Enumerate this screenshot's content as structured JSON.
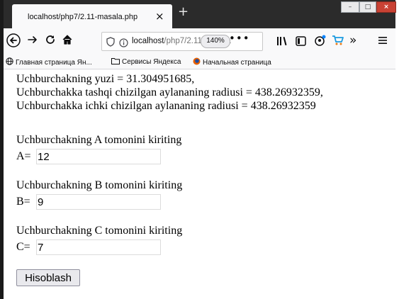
{
  "browser": {
    "tab_title": "localhost/php7/2.11-masala.php",
    "tab_close": "×",
    "new_tab": "+",
    "window_buttons": [
      "–",
      "□",
      "×"
    ],
    "url_host": "localhost",
    "url_path": "/php7/2.11-masala",
    "zoom": "140%",
    "menu_dots": "•••",
    "bookmarks": [
      {
        "icon": "globe-icon",
        "label": "Главная страница Ян..."
      },
      {
        "icon": "folder-icon",
        "label": "Сервисы Яндекса"
      },
      {
        "icon": "firefox-icon",
        "label": "Начальная страница"
      }
    ]
  },
  "results": {
    "area": "Uchburchakning yuzi = 31.304951685,",
    "circumradius": "Uchburchakka tashqi chizilgan aylananing radiusi = 438.26932359,",
    "inradius": "Uchburchakka ichki chizilgan aylananing radiusi = 438.26932359"
  },
  "form": {
    "a_label": "Uchburchakning A tomonini kiriting",
    "a_prefix": "A=",
    "a_value": "12",
    "b_label": "Uchburchakning B tomonini kiriting",
    "b_prefix": "B=",
    "b_value": "9",
    "c_label": "Uchburchakning C tomonini kiriting",
    "c_prefix": "C=",
    "c_value": "7",
    "submit_label": "Hisoblash"
  }
}
